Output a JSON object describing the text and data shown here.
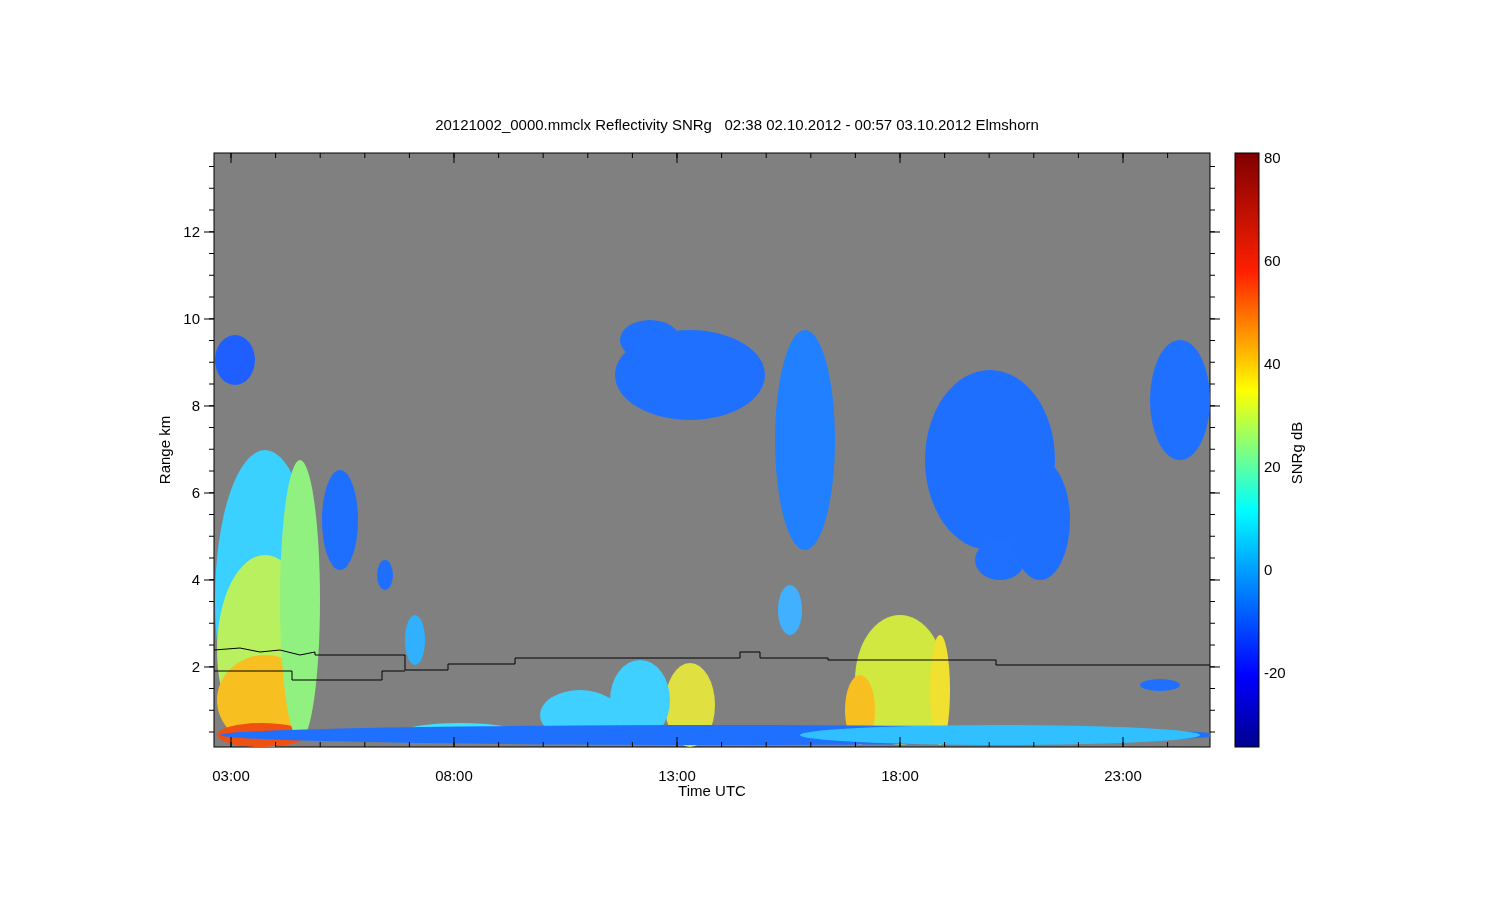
{
  "title": "20121002_0000.mmclx Reflectivity SNRg   02:38 02.10.2012 - 00:57 03.10.2012 Elmshorn",
  "x_axis": {
    "label": "Time UTC",
    "ticks": [
      "03:00",
      "08:00",
      "13:00",
      "18:00",
      "23:00"
    ]
  },
  "y_axis": {
    "label": "Range km",
    "ticks": [
      "12",
      "10",
      "8",
      "6",
      "4",
      "2"
    ]
  },
  "colorbar": {
    "label": "SNRg dB",
    "ticks": [
      "80",
      "60",
      "40",
      "20",
      "0",
      "-20"
    ]
  }
}
